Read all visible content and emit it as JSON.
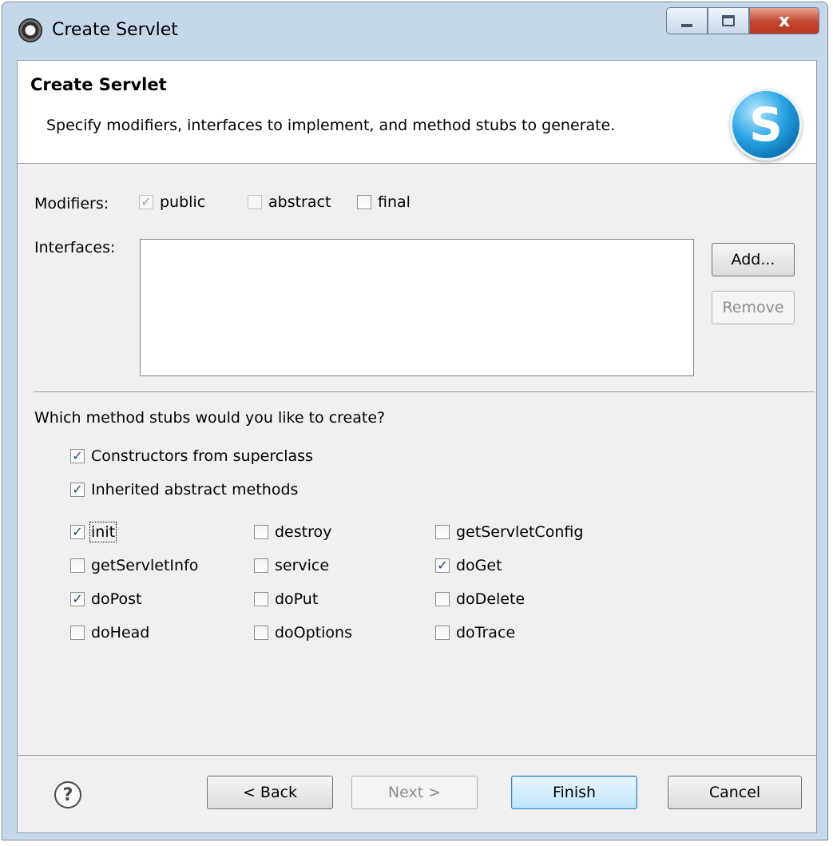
{
  "window": {
    "title": "Create Servlet",
    "close_glyph": "x"
  },
  "header": {
    "title": "Create Servlet",
    "description": "Specify modifiers, interfaces to implement, and method stubs to generate.",
    "logo_letter": "S"
  },
  "modifiers": {
    "label": "Modifiers:",
    "public": {
      "label": "public",
      "checked": true,
      "enabled": false
    },
    "abstract": {
      "label": "abstract",
      "checked": false,
      "enabled": false
    },
    "final": {
      "label": "final",
      "checked": false,
      "enabled": true
    }
  },
  "interfaces": {
    "label": "Interfaces:",
    "items": [],
    "add_label": "Add...",
    "remove_label": "Remove"
  },
  "stubs": {
    "question": "Which method stubs would you like to create?",
    "constructors": {
      "label": "Constructors from superclass",
      "checked": true
    },
    "inherited": {
      "label": "Inherited abstract methods",
      "checked": true
    },
    "methods": [
      {
        "label": "init",
        "checked": true
      },
      {
        "label": "destroy",
        "checked": false
      },
      {
        "label": "getServletConfig",
        "checked": false
      },
      {
        "label": "getServletInfo",
        "checked": false
      },
      {
        "label": "service",
        "checked": false
      },
      {
        "label": "doGet",
        "checked": true
      },
      {
        "label": "doPost",
        "checked": true
      },
      {
        "label": "doPut",
        "checked": false
      },
      {
        "label": "doDelete",
        "checked": false
      },
      {
        "label": "doHead",
        "checked": false
      },
      {
        "label": "doOptions",
        "checked": false
      },
      {
        "label": "doTrace",
        "checked": false
      }
    ]
  },
  "footer": {
    "help_glyph": "?",
    "back_label": "< Back",
    "next_label": "Next >",
    "finish_label": "Finish",
    "cancel_label": "Cancel"
  },
  "icons": {
    "checkmark": "✓",
    "eclipse": "eclipse-icon",
    "servlet": "servlet-logo-icon",
    "help": "help-icon"
  },
  "colors": {
    "accent": "#3c7fb1",
    "close": "#c2462f",
    "panel": "#f0f0f0",
    "frame": "#c5d8ea"
  }
}
